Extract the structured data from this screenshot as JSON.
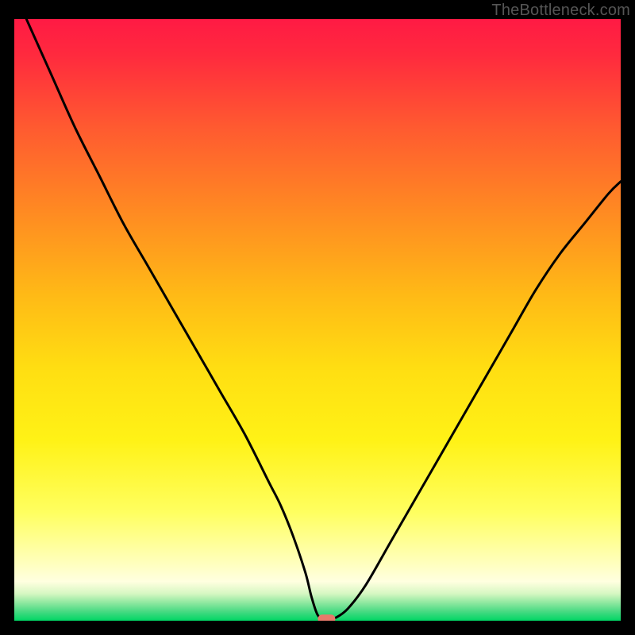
{
  "watermark": "TheBottleneck.com",
  "colors": {
    "background_black": "#000000",
    "curve_black": "#000000",
    "marker_red": "#e77a6b",
    "grad_top": "#ff1a44",
    "grad_mid_upper": "#ff6a2e",
    "grad_mid": "#ffd414",
    "grad_mid_lower": "#ffff66",
    "grad_band": "#ffffd0",
    "grad_green_top": "#9be89b",
    "grad_green_mid": "#5cd87e",
    "grad_bottom": "#00d664"
  },
  "chart_data": {
    "type": "line",
    "title": "",
    "xlabel": "",
    "ylabel": "",
    "xlim": [
      0,
      100
    ],
    "ylim": [
      0,
      100
    ],
    "x": [
      2,
      6,
      10,
      14,
      18,
      22,
      26,
      30,
      34,
      38,
      42,
      44,
      46,
      48,
      49,
      50,
      51,
      52,
      53,
      55,
      58,
      62,
      66,
      70,
      74,
      78,
      82,
      86,
      90,
      94,
      98,
      100
    ],
    "values": [
      100,
      91,
      82,
      74,
      66,
      59,
      52,
      45,
      38,
      31,
      23,
      19,
      14,
      8,
      4,
      1,
      0.3,
      0.3,
      0.5,
      2,
      6,
      13,
      20,
      27,
      34,
      41,
      48,
      55,
      61,
      66,
      71,
      73
    ],
    "marker": {
      "x": 51.5,
      "y": 0.3
    },
    "annotations": []
  }
}
